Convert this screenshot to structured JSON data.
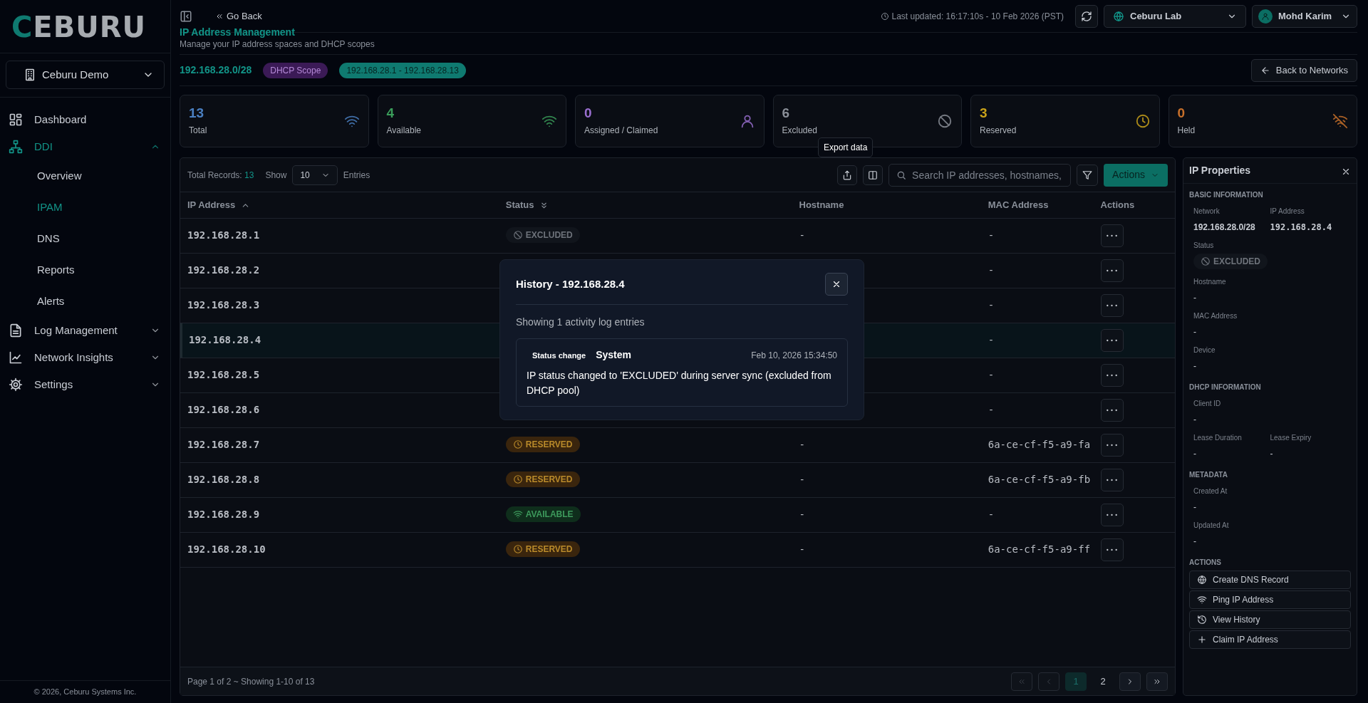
{
  "sidebar": {
    "logo": "CEBURU",
    "org_select": "Ceburu Demo",
    "nav": [
      {
        "label": "Dashboard",
        "selected": false
      },
      {
        "label": "DDI",
        "expanded": true,
        "children": [
          {
            "label": "Overview",
            "selected": false
          },
          {
            "label": "IPAM",
            "selected": true
          },
          {
            "label": "DNS",
            "selected": false
          },
          {
            "label": "Reports",
            "selected": false
          },
          {
            "label": "Alerts",
            "selected": false
          }
        ]
      },
      {
        "label": "Log Management",
        "selected": false,
        "expanded": false
      },
      {
        "label": "Network Insights",
        "selected": false,
        "expanded": false
      },
      {
        "label": "Settings",
        "selected": false,
        "expanded": false
      }
    ],
    "footer": "© 2026, Ceburu Systems Inc."
  },
  "header": {
    "back": "Go Back",
    "last_updated": "Last updated: 16:17:10s - 10 Feb 2026 (PST)",
    "site_select": "Ceburu Lab",
    "user": "Mohd Karim"
  },
  "page": {
    "title": "IP Address Management",
    "subtitle": "Manage your IP address spaces and DHCP scopes"
  },
  "network": {
    "cidr": "192.168.28.0/28",
    "type_badge": "DHCP Scope",
    "range_badge": "192.168.28.1 - 192.168.28.13",
    "back_button": "Back to Networks"
  },
  "stats": [
    {
      "value": "13",
      "label": "Total",
      "color": "#4a7fc1"
    },
    {
      "value": "4",
      "label": "Available",
      "color": "#3a9d5a"
    },
    {
      "value": "0",
      "label": "Assigned / Claimed",
      "color": "#9a6fd0"
    },
    {
      "value": "6",
      "label": "Excluded",
      "color": "#8a8f98"
    },
    {
      "value": "3",
      "label": "Reserved",
      "color": "#c9a21a"
    },
    {
      "value": "0",
      "label": "Held",
      "color": "#c8702a"
    }
  ],
  "table": {
    "total_label": "Total Records:",
    "total": "13",
    "show_label": "Show",
    "page_size": "10",
    "entries_label": "Entries",
    "export_tooltip": "Export data",
    "search_placeholder": "Search IP addresses, hostnames,",
    "actions_button": "Actions",
    "columns": [
      {
        "label": "IP Address"
      },
      {
        "label": "Status"
      },
      {
        "label": "Hostname"
      },
      {
        "label": "MAC Address"
      },
      {
        "label": "Actions"
      }
    ],
    "rows": [
      {
        "ip": "192.168.28.1",
        "status": {
          "kind": "excluded",
          "label": "EXCLUDED"
        },
        "hostname": "-",
        "mac": "-",
        "selected": false
      },
      {
        "ip": "192.168.28.2",
        "mac": "-",
        "selected": false
      },
      {
        "ip": "192.168.28.3",
        "mac": "-",
        "selected": false
      },
      {
        "ip": "192.168.28.4",
        "mac": "-",
        "selected": true
      },
      {
        "ip": "192.168.28.5",
        "mac": "-",
        "selected": false
      },
      {
        "ip": "192.168.28.6",
        "mac": "-",
        "selected": false
      },
      {
        "ip": "192.168.28.7",
        "status": {
          "kind": "reserved",
          "label": "RESERVED"
        },
        "hostname": "-",
        "mac": "6a-ce-cf-f5-a9-fa",
        "selected": false
      },
      {
        "ip": "192.168.28.8",
        "status": {
          "kind": "reserved",
          "label": "RESERVED"
        },
        "hostname": "-",
        "mac": "6a-ce-cf-f5-a9-fb",
        "selected": false
      },
      {
        "ip": "192.168.28.9",
        "status": {
          "kind": "available",
          "label": "AVAILABLE"
        },
        "hostname": "-",
        "mac": "-",
        "selected": false
      },
      {
        "ip": "192.168.28.10",
        "status": {
          "kind": "reserved",
          "label": "RESERVED"
        },
        "hostname": "-",
        "mac": "6a-ce-cf-f5-a9-ff",
        "selected": false
      }
    ],
    "footer": "Page 1 of 2 ~ Showing 1-10 of 13",
    "pages": [
      {
        "label": "1",
        "selected": true
      },
      {
        "label": "2",
        "selected": false
      }
    ],
    "prev_disabled": true,
    "next_disabled": false
  },
  "modal": {
    "title": "History - 192.168.28.4",
    "summary": "Showing 1 activity log entries",
    "entries": [
      {
        "type": "Status change",
        "actor": "System",
        "time": "Feb 10, 2026 15:34:50",
        "message": "IP status changed to 'EXCLUDED' during server sync (excluded from DHCP pool)"
      }
    ]
  },
  "properties": {
    "title": "IP Properties",
    "sections": [
      {
        "title": "BASIC INFORMATION",
        "rows": [
          [
            {
              "label": "Network",
              "value": "192.168.28.0/28",
              "kind": "text"
            },
            {
              "label": "IP Address",
              "value": "192.168.28.4",
              "kind": "mono"
            }
          ],
          [
            {
              "label": "Status",
              "kind": "status",
              "status": {
                "kind": "excluded",
                "label": "EXCLUDED"
              }
            }
          ],
          [
            {
              "label": "Hostname",
              "value": "-",
              "kind": "text"
            }
          ],
          [
            {
              "label": "MAC Address",
              "value": "-",
              "kind": "text"
            }
          ],
          [
            {
              "label": "Device",
              "value": "-",
              "kind": "text"
            }
          ]
        ]
      },
      {
        "title": "DHCP INFORMATION",
        "rows": [
          [
            {
              "label": "Client ID",
              "value": "-",
              "kind": "text"
            }
          ],
          [
            {
              "label": "Lease Duration",
              "value": "-",
              "kind": "text"
            },
            {
              "label": "Lease Expiry",
              "value": "-",
              "kind": "text"
            }
          ]
        ]
      },
      {
        "title": "METADATA",
        "rows": [
          [
            {
              "label": "Created At",
              "value": "-",
              "kind": "text"
            }
          ],
          [
            {
              "label": "Updated At",
              "value": "-",
              "kind": "text"
            }
          ]
        ]
      }
    ],
    "actions_title": "ACTIONS",
    "actions": [
      "Create DNS Record",
      "Ping IP Address",
      "View History",
      "Claim IP Address"
    ]
  }
}
